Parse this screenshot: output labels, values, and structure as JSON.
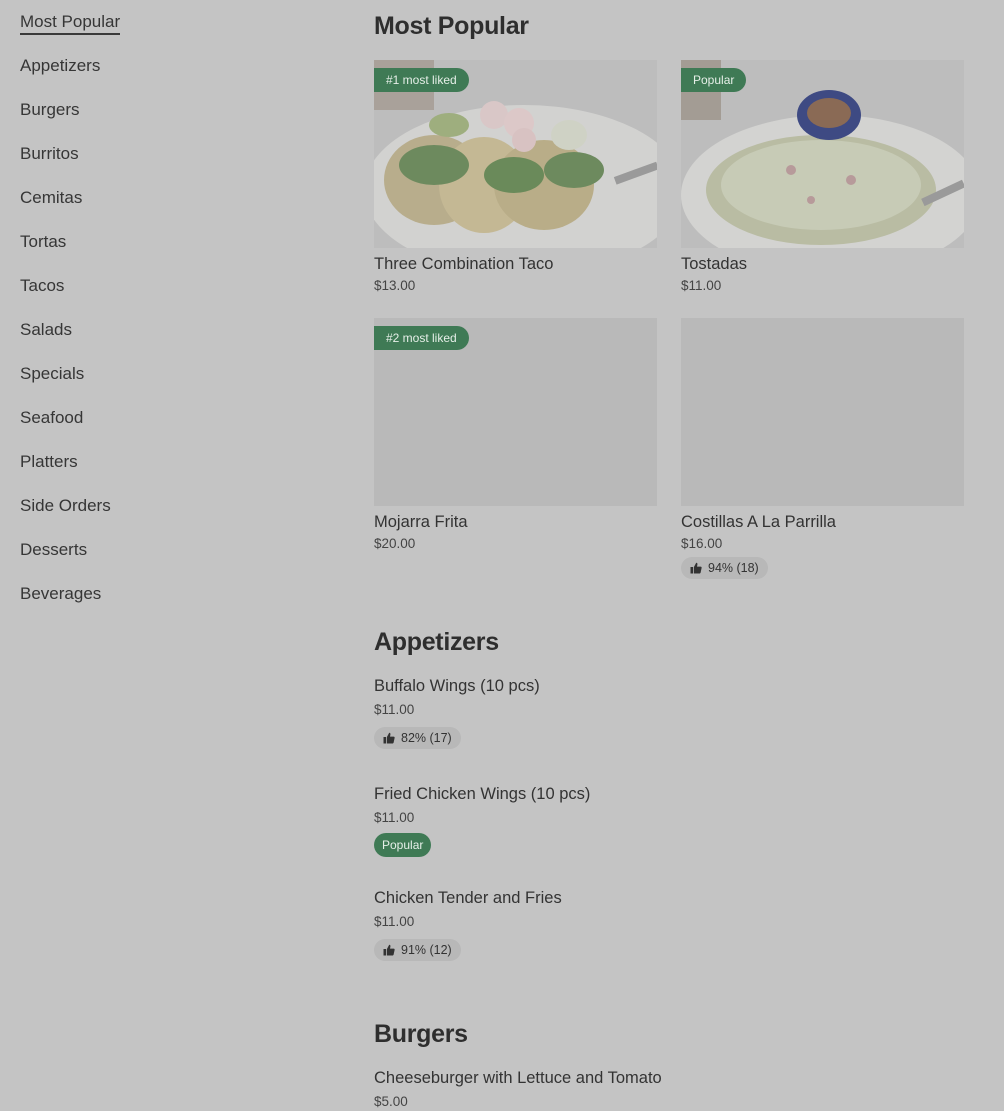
{
  "sidebar": {
    "items": [
      {
        "label": "Most Popular",
        "active": true
      },
      {
        "label": "Appetizers"
      },
      {
        "label": "Burgers"
      },
      {
        "label": "Burritos"
      },
      {
        "label": "Cemitas"
      },
      {
        "label": "Tortas"
      },
      {
        "label": "Tacos"
      },
      {
        "label": "Salads"
      },
      {
        "label": "Specials"
      },
      {
        "label": "Seafood"
      },
      {
        "label": "Platters"
      },
      {
        "label": "Side Orders"
      },
      {
        "label": "Desserts"
      },
      {
        "label": "Beverages"
      }
    ]
  },
  "sections": {
    "most_popular": {
      "title": "Most Popular",
      "cards": [
        {
          "name": "Three Combination Taco",
          "price": "$13.00",
          "badge": "#1 most liked"
        },
        {
          "name": "Tostadas",
          "price": "$11.00",
          "badge": "Popular"
        },
        {
          "name": "Mojarra Frita",
          "price": "$20.00",
          "badge": "#2 most liked"
        },
        {
          "name": "Costillas A La Parrilla",
          "price": "$16.00",
          "rating": "94% (18)"
        }
      ]
    },
    "appetizers": {
      "title": "Appetizers",
      "items": [
        {
          "name": "Buffalo Wings (10 pcs)",
          "price": "$11.00",
          "rating": "82% (17)"
        },
        {
          "name": "Fried Chicken Wings (10 pcs)",
          "price": "$11.00",
          "badge": "Popular"
        },
        {
          "name": "Chicken Tender and Fries",
          "price": "$11.00",
          "rating": "91% (12)"
        }
      ]
    },
    "burgers": {
      "title": "Burgers",
      "items": [
        {
          "name": "Cheeseburger with Lettuce and Tomato",
          "price": "$5.00"
        }
      ]
    }
  },
  "colors": {
    "overlay_background": "#c4c4c4",
    "badge_green": "#3f7a55"
  }
}
